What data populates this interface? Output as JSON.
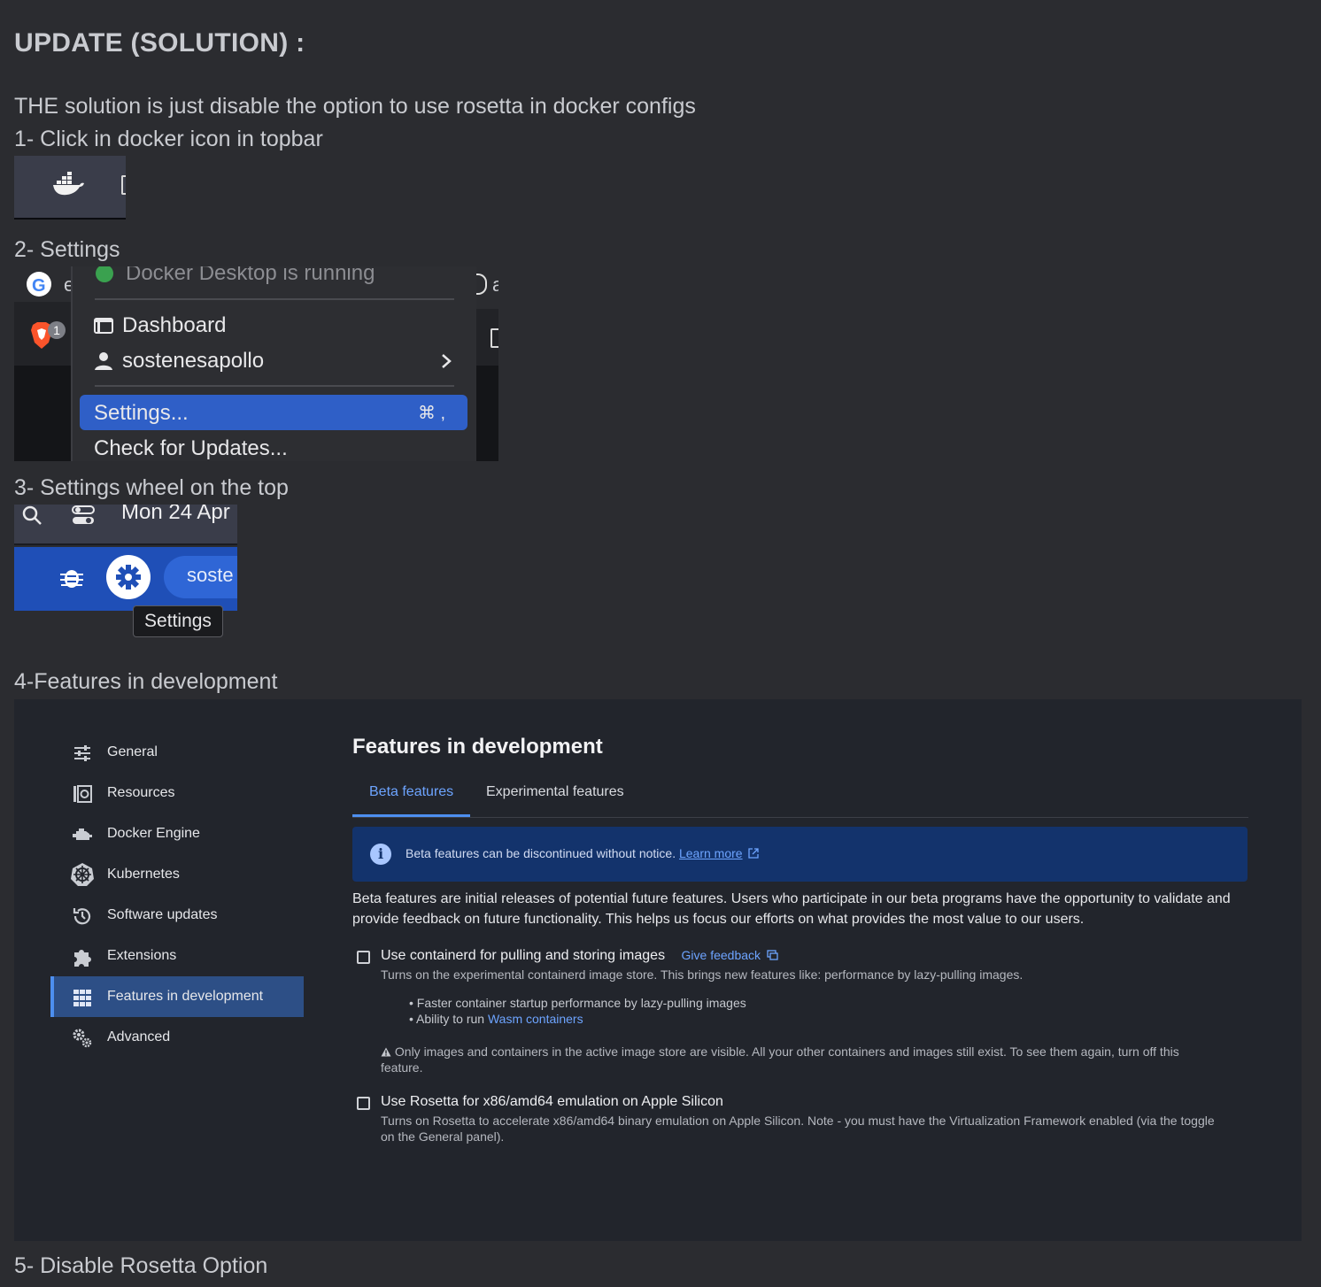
{
  "heading": "UPDATE (SOLUTION) :",
  "intro": "THE solution is just disable the option to use rosetta in docker configs",
  "steps": {
    "s1": "1- Click in docker icon in topbar",
    "s2": "2- Settings",
    "s3": "3- Settings wheel on the top",
    "s4": "4-Features in development",
    "s5": "5- Disable Rosetta Option"
  },
  "docker_menu": {
    "status": "Docker Desktop is running",
    "dashboard": "Dashboard",
    "user": "sostenesapollo",
    "settings": "Settings...",
    "settings_shortcut": "⌘ ,",
    "check_updates": "Check for Updates...",
    "left_letter": "e",
    "right_letter": "a",
    "badge_count": "1"
  },
  "topbar": {
    "date": "Mon 24 Apr",
    "user_pill": "soste",
    "tooltip": "Settings"
  },
  "settings_panel": {
    "nav": [
      {
        "label": "General",
        "icon": "sliders-icon"
      },
      {
        "label": "Resources",
        "icon": "resources-icon"
      },
      {
        "label": "Docker Engine",
        "icon": "engine-icon"
      },
      {
        "label": "Kubernetes",
        "icon": "kubernetes-icon"
      },
      {
        "label": "Software updates",
        "icon": "history-icon"
      },
      {
        "label": "Extensions",
        "icon": "puzzle-icon"
      },
      {
        "label": "Features in development",
        "icon": "grid-icon"
      },
      {
        "label": "Advanced",
        "icon": "gears-icon"
      }
    ],
    "title": "Features in development",
    "tabs": [
      "Beta features",
      "Experimental features"
    ],
    "info_text": "Beta features can be discontinued without notice.",
    "info_link": "Learn more",
    "description": "Beta features are initial releases of potential future features. Users who participate in our beta programs have the opportunity to validate and provide feedback on future functionality. This helps us focus our efforts on what provides the most value to our users.",
    "option1": {
      "title": "Use containerd for pulling and storing images",
      "feedback": "Give feedback",
      "desc": "Turns on the experimental containerd image store. This brings new features like: performance by lazy-pulling images.",
      "bullet1": "Faster container startup performance by lazy-pulling images",
      "bullet2_prefix": "Ability to run",
      "bullet2_link": "Wasm containers",
      "warning_line1": "Only images and containers in the active image store are visible. All your other containers and images still exist. To see them again, turn off this",
      "warning_line2": "feature."
    },
    "option2": {
      "title": "Use Rosetta for x86/amd64 emulation on Apple Silicon",
      "desc_line1": "Turns on Rosetta to accelerate x86/amd64 binary emulation on Apple Silicon. Note - you must have the Virtualization Framework enabled (via the toggle",
      "desc_line2": "on the General panel)."
    }
  }
}
